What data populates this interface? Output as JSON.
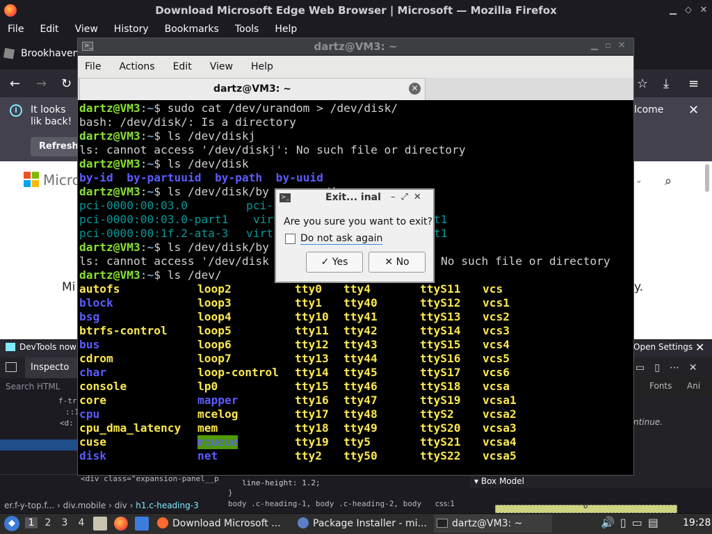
{
  "firefox": {
    "window_title": "Download Microsoft Edge Web Browser | Microsoft — Mozilla Firefox",
    "menu": [
      "File",
      "Edit",
      "View",
      "History",
      "Bookmarks",
      "Tools",
      "Help"
    ],
    "tab_label": "Brookhaven",
    "notice": {
      "text": "It looks lik back!",
      "refresh_label": "Refresh",
      "right_text": "lcome"
    },
    "page": {
      "brand_text": "Micro",
      "left_text": "Mi",
      "right_text": "y."
    },
    "devtools": {
      "banner_text": "DevTools now f",
      "open_settings": "Open Settings",
      "inspector_tab": "Inspecto",
      "search_placeholder": "Search HTML",
      "fonts_tab": "Fonts",
      "animations_tab": "Ani",
      "markup_lines": [
        "f-tr",
        "::1",
        "<d:",
        "",
        "",
        "",
        ""
      ],
      "rule_hint": "ntinue.",
      "html_snippet": "<div class=\"expansion-panel__p",
      "css_line_height": "line-height: 1.2;",
      "css_close": "}",
      "box_model": "Box Model",
      "box_model_value": "0",
      "breadcrumbs": [
        "er.f-y-top.f...",
        "div.mobile",
        "div",
        "h1.c-heading-3"
      ],
      "selector_text": "body .c-heading-1, body .c-heading-2, body",
      "css_source": "css:1"
    }
  },
  "terminal": {
    "window_title": "dartz@VM3: ~",
    "menu": [
      "File",
      "Actions",
      "Edit",
      "View",
      "Help"
    ],
    "tab_title": "dartz@VM3: ~",
    "prompt_user": "dartz@VM3",
    "lines": {
      "l1_cmd": "sudo cat /dev/urandom > /dev/disk/",
      "l2": "bash: /dev/disk/: Is a directory",
      "l3_cmd": "ls /dev/diskj",
      "l4": "ls: cannot access '/dev/diskj': No such file or directory",
      "l5_cmd": "ls /dev/disk",
      "l6": [
        "by-id",
        "by-partuuid",
        "by-path",
        "by-uuid"
      ],
      "l7_cmd": "ls /dev/disk/by",
      "l7_tail": "path",
      "l8": [
        "pci-0000:00:03.0",
        "pci-"
      ],
      "l9": [
        "pci-0000:00:03.0-part1",
        "virt",
        "rt1"
      ],
      "l10": [
        "pci-0000:00:1f.2-ata-3",
        "virt",
        "t1"
      ],
      "l11_cmd": "ls /dev/disk/by",
      "l12_a": "ls: cannot access '/dev/disk",
      "l12_b": "No such file or directory",
      "l13_cmd": "ls /dev/"
    },
    "dev_listing": [
      [
        "autofs",
        "loop2",
        "tty0",
        "tty4",
        "ttyS11",
        "vcs"
      ],
      [
        "block",
        "loop3",
        "tty1",
        "tty40",
        "ttyS12",
        "vcs1"
      ],
      [
        "bsg",
        "loop4",
        "tty10",
        "tty41",
        "ttyS13",
        "vcs2"
      ],
      [
        "btrfs-control",
        "loop5",
        "tty11",
        "tty42",
        "ttyS14",
        "vcs3"
      ],
      [
        "bus",
        "loop6",
        "tty12",
        "tty43",
        "ttyS15",
        "vcs4"
      ],
      [
        "cdrom",
        "loop7",
        "tty13",
        "tty44",
        "ttyS16",
        "vcs5"
      ],
      [
        "char",
        "loop-control",
        "tty14",
        "tty45",
        "ttyS17",
        "vcs6"
      ],
      [
        "console",
        "lp0",
        "tty15",
        "tty46",
        "ttyS18",
        "vcsa"
      ],
      [
        "core",
        "mapper",
        "tty16",
        "tty47",
        "ttyS19",
        "vcsa1"
      ],
      [
        "cpu",
        "mcelog",
        "tty17",
        "tty48",
        "ttyS2",
        "vcsa2"
      ],
      [
        "cpu_dma_latency",
        "mem",
        "tty18",
        "tty49",
        "ttyS20",
        "vcsa3"
      ],
      [
        "cuse",
        "mqueue",
        "tty19",
        "tty5",
        "ttyS21",
        "vcsa4"
      ],
      [
        "disk",
        "net",
        "tty2",
        "tty50",
        "ttyS22",
        "vcsa5"
      ]
    ],
    "dev_colors": [
      [
        "y",
        "y",
        "y",
        "y",
        "y",
        "y"
      ],
      [
        "bl",
        "y",
        "y",
        "y",
        "y",
        "y"
      ],
      [
        "bl",
        "y",
        "y",
        "y",
        "y",
        "y"
      ],
      [
        "y",
        "y",
        "y",
        "y",
        "y",
        "y"
      ],
      [
        "bl",
        "y",
        "y",
        "y",
        "y",
        "y"
      ],
      [
        "y",
        "y",
        "y",
        "y",
        "y",
        "y"
      ],
      [
        "bl",
        "y",
        "y",
        "y",
        "y",
        "y"
      ],
      [
        "y",
        "y",
        "y",
        "y",
        "y",
        "y"
      ],
      [
        "y",
        "bl",
        "y",
        "y",
        "y",
        "y"
      ],
      [
        "bl",
        "y",
        "y",
        "y",
        "y",
        "y"
      ],
      [
        "y",
        "y",
        "y",
        "y",
        "y",
        "y"
      ],
      [
        "y",
        "hl",
        "y",
        "y",
        "y",
        "y"
      ],
      [
        "bl",
        "bl",
        "y",
        "y",
        "y",
        "y"
      ]
    ]
  },
  "dialog": {
    "title": "Exit... inal",
    "question": "Are you sure you want to exit?",
    "checkbox_label": "Do not ask again",
    "yes_label": "Yes",
    "no_label": "No"
  },
  "taskbar": {
    "workspaces": [
      "1",
      "2",
      "3",
      "4"
    ],
    "tasks": [
      "Download Microsoft ...",
      "Package Installer - mi...",
      "dartz@VM3: ~"
    ],
    "clock": "19:28"
  }
}
